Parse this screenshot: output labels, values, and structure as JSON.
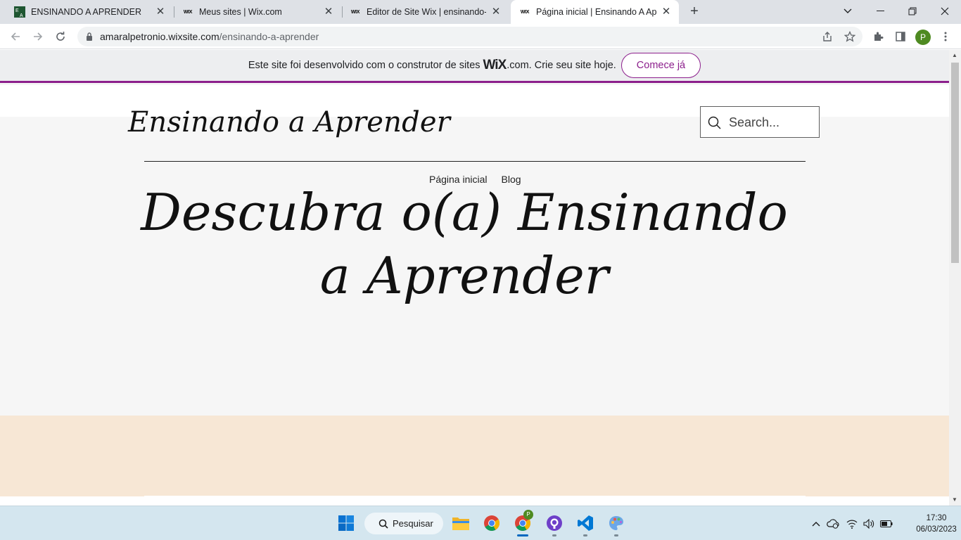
{
  "browser": {
    "tabs": [
      {
        "title": "ENSINANDO A APRENDER",
        "favicon": "ea-logo-icon",
        "active": false
      },
      {
        "title": "Meus sites | Wix.com",
        "favicon": "wix-icon",
        "active": false
      },
      {
        "title": "Editor de Site Wix | ensinando-a-",
        "favicon": "wix-icon",
        "active": false
      },
      {
        "title": "Página inicial | Ensinando A Apre",
        "favicon": "wix-icon",
        "active": true
      }
    ],
    "favicon_text": "WIX",
    "url_host": "amaralpetronio.wixsite.com",
    "url_path": "/ensinando-a-aprender",
    "profile_initial": "P",
    "profile_color": "#4e8a21"
  },
  "wix_banner": {
    "text_before": "Este site foi desenvolvido com o construtor de sites",
    "logo": "WiX",
    "text_after": ".com. Crie seu site hoje.",
    "cta": "Comece já",
    "accent": "#8c1f8c"
  },
  "site": {
    "title": "Ensinando a Aprender",
    "search_placeholder": "Search...",
    "nav": [
      "Página inicial",
      "Blog"
    ],
    "hero": "Descubra o(a) Ensinando a Aprender",
    "background": "#f6f6f6",
    "section_color": "#f7e7d5"
  },
  "taskbar": {
    "search_label": "Pesquisar",
    "time": "17:30",
    "date": "06/03/2023",
    "chrome_badge": "P"
  }
}
